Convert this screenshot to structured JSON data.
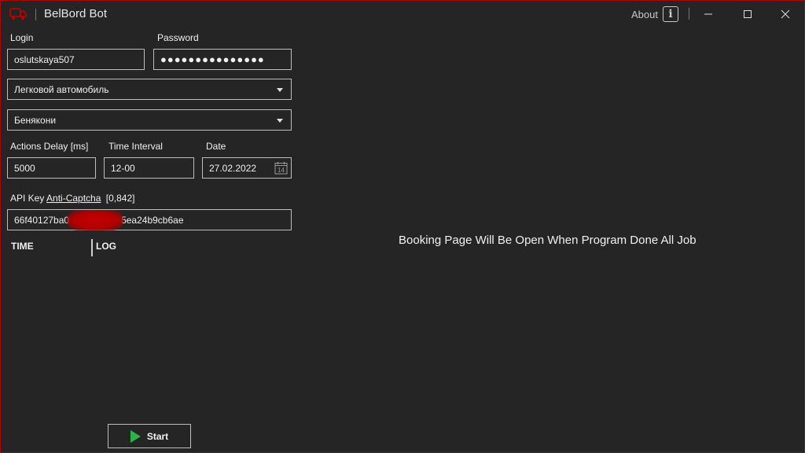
{
  "app": {
    "title": "BelBord Bot",
    "about_label": "About",
    "accent_color": "#b00000"
  },
  "form": {
    "login_label": "Login",
    "login_value": "oslutskaya507",
    "password_label": "Password",
    "password_value": "●●●●●●●●●●●●●●●",
    "vehicle_selected": "Легковой автомобиль",
    "checkpoint_selected": "Бенякони",
    "delay_label": "Actions Delay [ms]",
    "delay_value": "5000",
    "interval_label": "Time Interval",
    "interval_value": "12-00",
    "date_label": "Date",
    "date_value": "27.02.2022",
    "calendar_day": "14",
    "api_key_label": "API Key",
    "api_key_link": "Anti-Captcha",
    "api_key_balance": "[0,842]",
    "api_key_value_start": "66f40127ba0",
    "api_key_value_end": "5ea24b9cb6ae"
  },
  "log": {
    "columns": [
      "TIME",
      "LOG"
    ]
  },
  "actions": {
    "start_label": "Start",
    "start_icon_color": "#2bb34a"
  },
  "booking": {
    "message": "Booking Page Will Be Open When Program Done All Job"
  }
}
